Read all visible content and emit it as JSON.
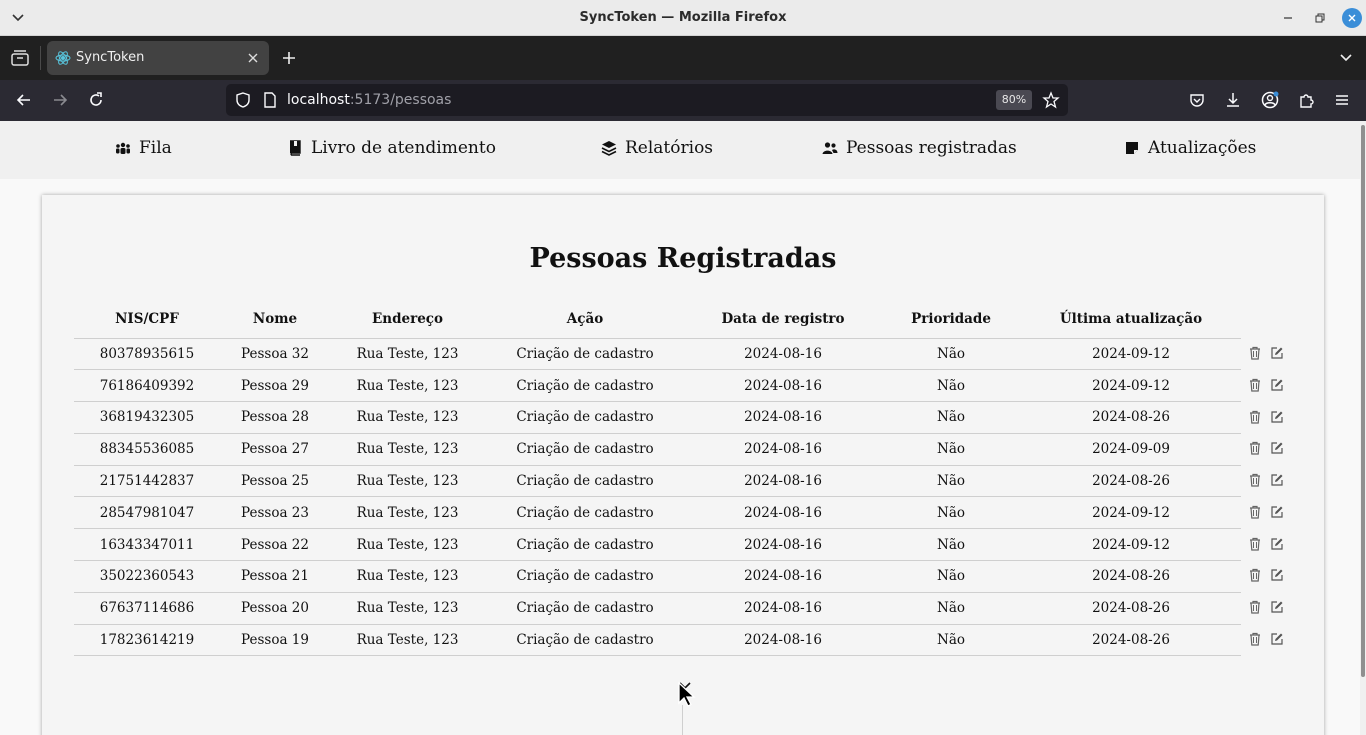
{
  "window": {
    "title": "SyncToken — Mozilla Firefox"
  },
  "browser": {
    "tab_title": "SyncToken",
    "url_host": "localhost",
    "url_path": ":5173/pessoas",
    "zoom": "80%"
  },
  "nav": {
    "items": [
      {
        "label": "Fila",
        "icon": "users-group-icon"
      },
      {
        "label": "Livro de atendimento",
        "icon": "book-icon"
      },
      {
        "label": "Relatórios",
        "icon": "layers-icon"
      },
      {
        "label": "Pessoas registradas",
        "icon": "user-group-icon"
      },
      {
        "label": "Atualizações",
        "icon": "note-icon"
      }
    ]
  },
  "page": {
    "title": "Pessoas Registradas",
    "columns": [
      "NIS/CPF",
      "Nome",
      "Endereço",
      "Ação",
      "Data de registro",
      "Prioridade",
      "Última atualização"
    ],
    "rows": [
      [
        "80378935615",
        "Pessoa 32",
        "Rua Teste, 123",
        "Criação de cadastro",
        "2024-08-16",
        "Não",
        "2024-09-12"
      ],
      [
        "76186409392",
        "Pessoa 29",
        "Rua Teste, 123",
        "Criação de cadastro",
        "2024-08-16",
        "Não",
        "2024-09-12"
      ],
      [
        "36819432305",
        "Pessoa 28",
        "Rua Teste, 123",
        "Criação de cadastro",
        "2024-08-16",
        "Não",
        "2024-08-26"
      ],
      [
        "88345536085",
        "Pessoa 27",
        "Rua Teste, 123",
        "Criação de cadastro",
        "2024-08-16",
        "Não",
        "2024-09-09"
      ],
      [
        "21751442837",
        "Pessoa 25",
        "Rua Teste, 123",
        "Criação de cadastro",
        "2024-08-16",
        "Não",
        "2024-08-26"
      ],
      [
        "28547981047",
        "Pessoa 23",
        "Rua Teste, 123",
        "Criação de cadastro",
        "2024-08-16",
        "Não",
        "2024-09-12"
      ],
      [
        "16343347011",
        "Pessoa 22",
        "Rua Teste, 123",
        "Criação de cadastro",
        "2024-08-16",
        "Não",
        "2024-09-12"
      ],
      [
        "35022360543",
        "Pessoa 21",
        "Rua Teste, 123",
        "Criação de cadastro",
        "2024-08-16",
        "Não",
        "2024-08-26"
      ],
      [
        "67637114686",
        "Pessoa 20",
        "Rua Teste, 123",
        "Criação de cadastro",
        "2024-08-16",
        "Não",
        "2024-08-26"
      ],
      [
        "17823614219",
        "Pessoa 19",
        "Rua Teste, 123",
        "Criação de cadastro",
        "2024-08-16",
        "Não",
        "2024-08-26"
      ]
    ]
  },
  "colors": {
    "accent": "#3b8ed8",
    "tabstrip": "#202020",
    "navbar": "#2b2a33"
  }
}
